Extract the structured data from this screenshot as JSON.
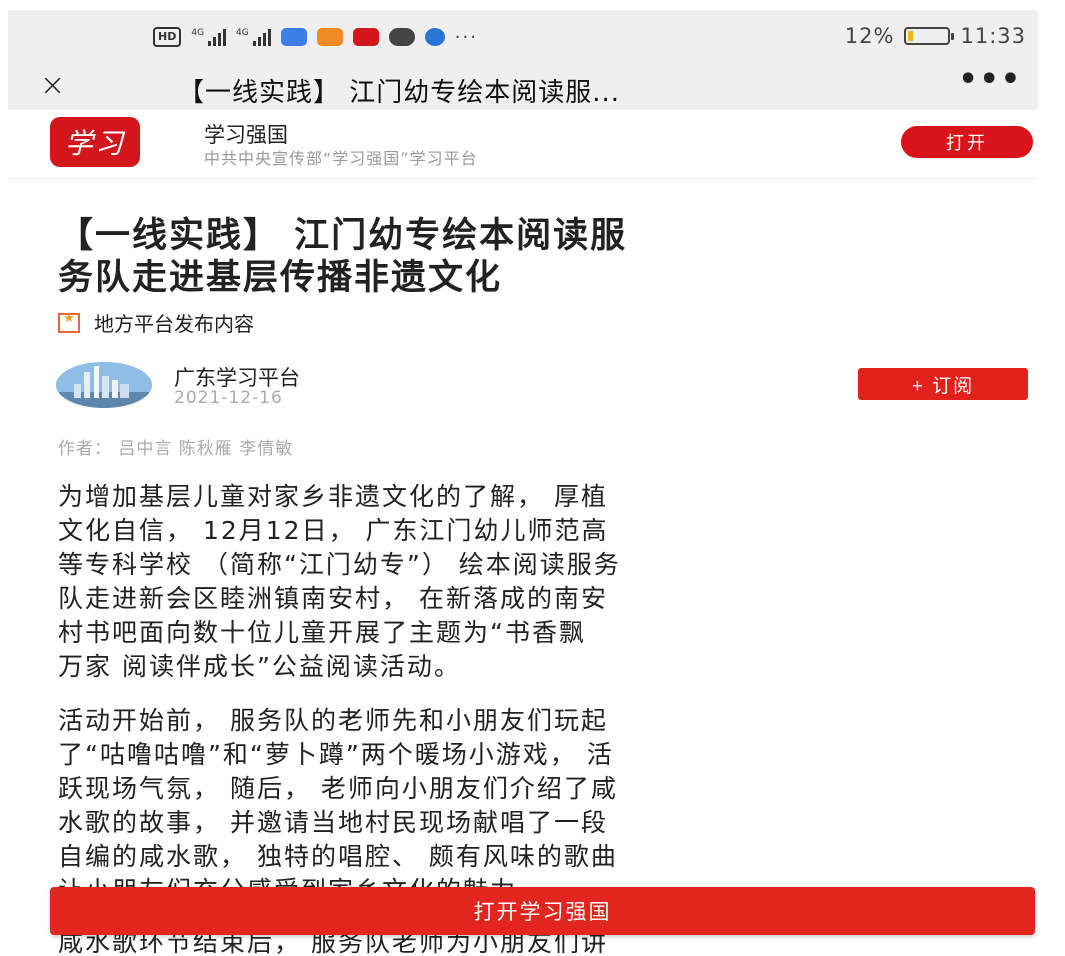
{
  "status_bar": {
    "hd": "HD",
    "signal_1": "4G",
    "signal_2": "4G",
    "more": "···",
    "battery_text": "12%",
    "battery_level_percent": 12,
    "time": "11:33",
    "colors": {
      "battery_fill": "#f3b11b",
      "app_icons": [
        "#3a7ee6",
        "#f08a24",
        "#d3161b",
        "#444444",
        "#2a74d8"
      ]
    }
  },
  "nav": {
    "close_icon": "×",
    "title": "【一线实践】 江门幼专绘本阅读服...",
    "more_icon": "•••"
  },
  "banner": {
    "logo_text": "学习",
    "app_name": "学习强国",
    "app_desc": "中共中央宣传部“学习强国”学习平台",
    "open_label": "打开",
    "brand_color": "#d8141a"
  },
  "article": {
    "title_lines": [
      "【一线实践】 江门幼专绘本阅读服",
      "务队走进基层传播非遗文化"
    ],
    "source_label": "地方平台发布内容",
    "publisher": "广东学习平台",
    "date": "2021-12-16",
    "subscribe_label": "+ 订阅",
    "author_line": "作者： 吕中言 陈秋雁 李倩敏",
    "para1_lines": [
      "为增加基层儿童对家乡非遗文化的了解， 厚植",
      "文化自信， 12月12日， 广东江门幼儿师范高",
      "等专科学校 （简称“江门幼专”） 绘本阅读服务",
      "队走进新会区睦洲镇南安村， 在新落成的南安",
      "村书吧面向数十位儿童开展了主题为“书香飘",
      "万家 阅读伴成长”公益阅读活动。"
    ],
    "para2_lines": [
      "活动开始前， 服务队的老师先和小朋友们玩起",
      "了“咕噜咕噜”和“萝卜蹲”两个暖场小游戏， 活",
      "跃现场气氛， 随后， 老师向小朋友们介绍了咸",
      "水歌的故事， 并邀请当地村民现场献唱了一段",
      "自编的咸水歌， 独特的唱腔、 颇有风味的歌曲",
      "让小朋友们充分感受到家乡文化的魅力。"
    ],
    "para3_lines": [
      "咸水歌环节结束后， 服务队老师为小朋友们讲"
    ]
  },
  "bottom_bar": {
    "open_app_label": "打开学习强国"
  }
}
